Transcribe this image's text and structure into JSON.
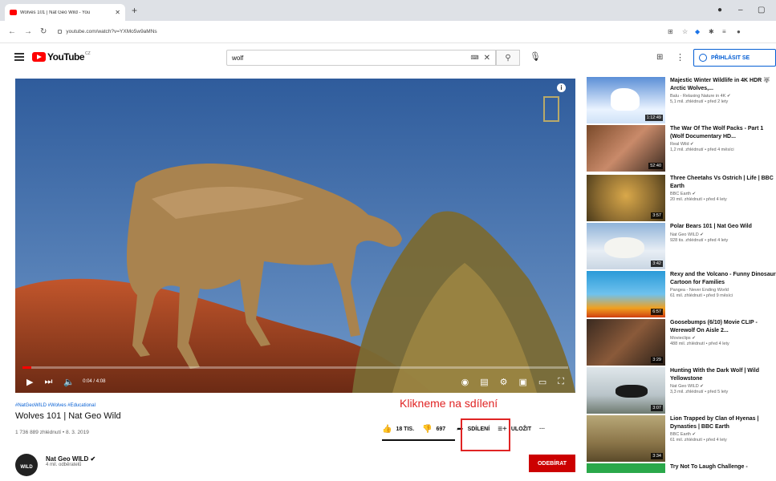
{
  "browser": {
    "tab_title": "Wolves 101 | Nat Geo Wild - You",
    "url": "youtube.com/watch?v=YXMo5w9aMNs"
  },
  "youtube": {
    "logo_text": "YouTube",
    "region": "CZ",
    "search_value": "wolf",
    "signin_label": "PŘIHLÁSIT SE"
  },
  "player": {
    "time": "0:04 / 4:08",
    "progress": 0.016
  },
  "video": {
    "hashtags": "#NatGeoWILD #Wolves #Educational",
    "title": "Wolves 101 | Nat Geo Wild",
    "meta": "1 736 889 zhlédnutí • 8. 3. 2019",
    "likes": "18 TIS.",
    "dislikes": "697",
    "share_label": "SDÍLENÍ",
    "save_label": "ULOŽIT",
    "more_label": "···",
    "annotation": "Klikneme na sdílení"
  },
  "channel": {
    "avatar_text": "WILD",
    "name": "Nat Geo WILD ✔",
    "subscribers": "4 mil. odběratelů",
    "subscribe_label": "ODEBÍRAT"
  },
  "related": [
    {
      "title": "Majestic Winter Wildlife in 4K HDR 🐺 Arctic Wolves,...",
      "channel": "Balu - Relaxing Nature in 4K ✔",
      "stats": "5,1 mil. zhlédnutí • před 2 lety",
      "duration": "1:12:49"
    },
    {
      "title": "The War Of The Wolf Packs - Part 1 (Wolf Documentary HD...",
      "channel": "Real Wild ✔",
      "stats": "1,2 mil. zhlédnutí • před 4 měsíci",
      "duration": "52:40"
    },
    {
      "title": "Three Cheetahs Vs Ostrich | Life | BBC Earth",
      "channel": "BBC Earth ✔",
      "stats": "20 mil. zhlédnutí • před 4 lety",
      "duration": "3:57"
    },
    {
      "title": "Polar Bears 101 | Nat Geo Wild",
      "channel": "Nat Geo WILD ✔",
      "stats": "928 tis. zhlédnutí • před 4 lety",
      "duration": "3:42"
    },
    {
      "title": "Rexy and the Volcano - Funny Dinosaur Cartoon for Families",
      "channel": "Pangea - Never Ending World",
      "stats": "61 mil. zhlédnutí • před 9 měsíci",
      "duration": "6:57"
    },
    {
      "title": "Goosebumps (6/10) Movie CLIP - Werewolf On Aisle 2...",
      "channel": "Movieclips ✔",
      "stats": "488 mil. zhlédnutí • před 4 lety",
      "duration": "3:29"
    },
    {
      "title": "Hunting With the Dark Wolf | Wild Yellowstone",
      "channel": "Nat Geo WILD ✔",
      "stats": "3,3 mil. zhlédnutí • před 5 lety",
      "duration": "3:07"
    },
    {
      "title": "Lion Trapped by Clan of Hyenas | Dynasties | BBC Earth",
      "channel": "BBC Earth ✔",
      "stats": "61 mil. zhlédnutí • před 4 lety",
      "duration": "3:34"
    },
    {
      "title": "Try Not To Laugh Challenge -",
      "channel": "",
      "stats": "",
      "duration": ""
    }
  ]
}
